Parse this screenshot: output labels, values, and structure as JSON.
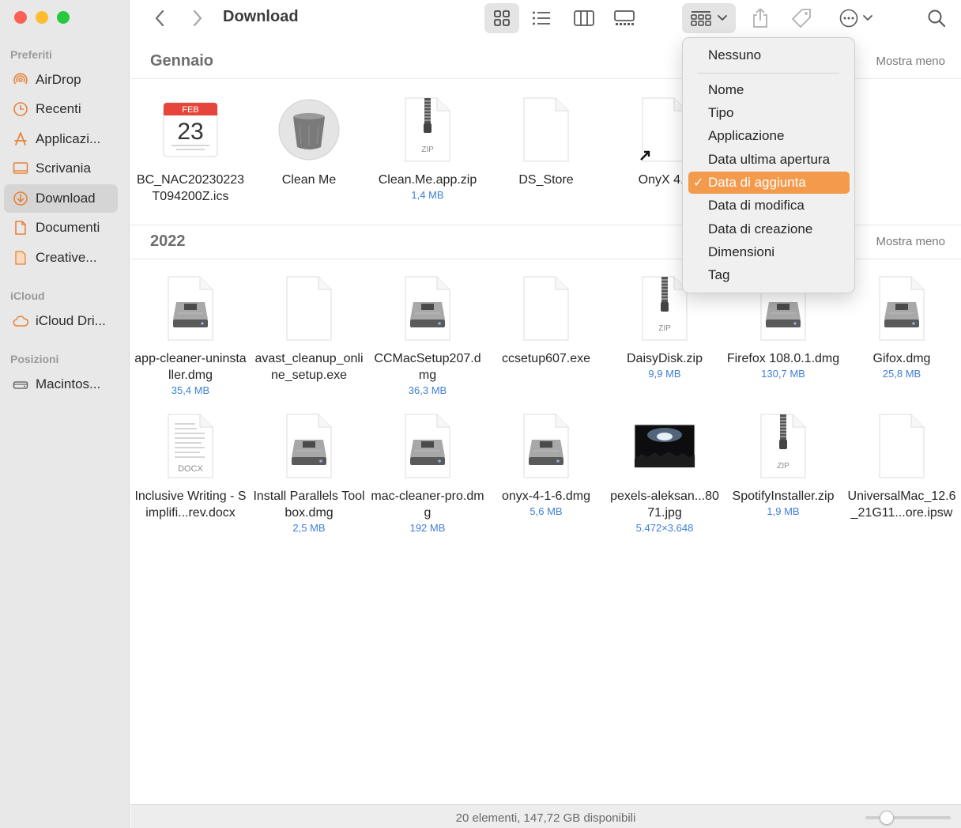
{
  "window": {
    "title": "Download"
  },
  "sidebar": {
    "sections": [
      {
        "title": "Preferiti",
        "items": [
          {
            "label": "AirDrop",
            "icon": "airdrop-icon"
          },
          {
            "label": "Recenti",
            "icon": "clock-icon"
          },
          {
            "label": "Applicazi...",
            "icon": "applications-icon"
          },
          {
            "label": "Scrivania",
            "icon": "desktop-icon"
          },
          {
            "label": "Download",
            "icon": "download-icon",
            "active": true
          },
          {
            "label": "Documenti",
            "icon": "document-icon"
          },
          {
            "label": "Creative...",
            "icon": "folder-doc-icon"
          }
        ]
      },
      {
        "title": "iCloud",
        "items": [
          {
            "label": "iCloud Dri...",
            "icon": "cloud-icon"
          }
        ]
      },
      {
        "title": "Posizioni",
        "items": [
          {
            "label": "Macintos...",
            "icon": "disk-icon"
          }
        ]
      }
    ]
  },
  "groups": [
    {
      "title": "Gennaio",
      "toggle": "Mostra meno",
      "files": [
        {
          "name": "BC_NAC20230223T094200Z.ics",
          "meta": "",
          "kind": "calendar",
          "cal_month": "FEB",
          "cal_day": "23"
        },
        {
          "name": "Clean Me",
          "meta": "",
          "kind": "trash"
        },
        {
          "name": "Clean.Me.app.zip",
          "meta": "1,4 MB",
          "kind": "zip",
          "badge": "ZIP"
        },
        {
          "name": "DS_Store",
          "meta": "",
          "kind": "blank"
        },
        {
          "name": "OnyX 4.3",
          "meta": "",
          "kind": "alias"
        }
      ]
    },
    {
      "title": "2022",
      "toggle": "Mostra meno",
      "files": [
        {
          "name": "app-cleaner-uninstaller.dmg",
          "meta": "35,4 MB",
          "kind": "dmg"
        },
        {
          "name": "avast_cleanup_online_setup.exe",
          "meta": "",
          "kind": "blank"
        },
        {
          "name": "CCMacSetup207.dmg",
          "meta": "36,3 MB",
          "kind": "dmg"
        },
        {
          "name": "ccsetup607.exe",
          "meta": "",
          "kind": "blank"
        },
        {
          "name": "DaisyDisk.zip",
          "meta": "9,9 MB",
          "kind": "zip",
          "badge": "ZIP"
        },
        {
          "name": "Firefox 108.0.1.dmg",
          "meta": "130,7 MB",
          "kind": "dmg"
        },
        {
          "name": "Gifox.dmg",
          "meta": "25,8 MB",
          "kind": "dmg"
        },
        {
          "name": "Inclusive Writing - Simplifi...rev.docx",
          "meta": "",
          "kind": "docx",
          "badge": "DOCX"
        },
        {
          "name": "Install Parallels Toolbox.dmg",
          "meta": "2,5 MB",
          "kind": "dmg"
        },
        {
          "name": "mac-cleaner-pro.dmg",
          "meta": "192 MB",
          "kind": "dmg"
        },
        {
          "name": "onyx-4-1-6.dmg",
          "meta": "5,6 MB",
          "kind": "dmg"
        },
        {
          "name": "pexels-aleksan...8071.jpg",
          "meta": "5.472×3.648",
          "kind": "image"
        },
        {
          "name": "SpotifyInstaller.zip",
          "meta": "1,9 MB",
          "kind": "zip",
          "badge": "ZIP"
        },
        {
          "name": "UniversalMac_12.6_21G11...ore.ipsw",
          "meta": "",
          "kind": "blank"
        }
      ]
    }
  ],
  "sort_menu": {
    "items": [
      "Nessuno",
      "Nome",
      "Tipo",
      "Applicazione",
      "Data ultima apertura",
      "Data di aggiunta",
      "Data di modifica",
      "Data di creazione",
      "Dimensioni",
      "Tag"
    ],
    "selected": "Data di aggiunta",
    "check": "✓"
  },
  "status": {
    "text": "20 elementi, 147,72 GB disponibili",
    "zoom": 0.2
  },
  "colors": {
    "accent": "#f39a4d",
    "sidebar_icon": "#e8823a",
    "meta_text": "#3f7fd8"
  }
}
